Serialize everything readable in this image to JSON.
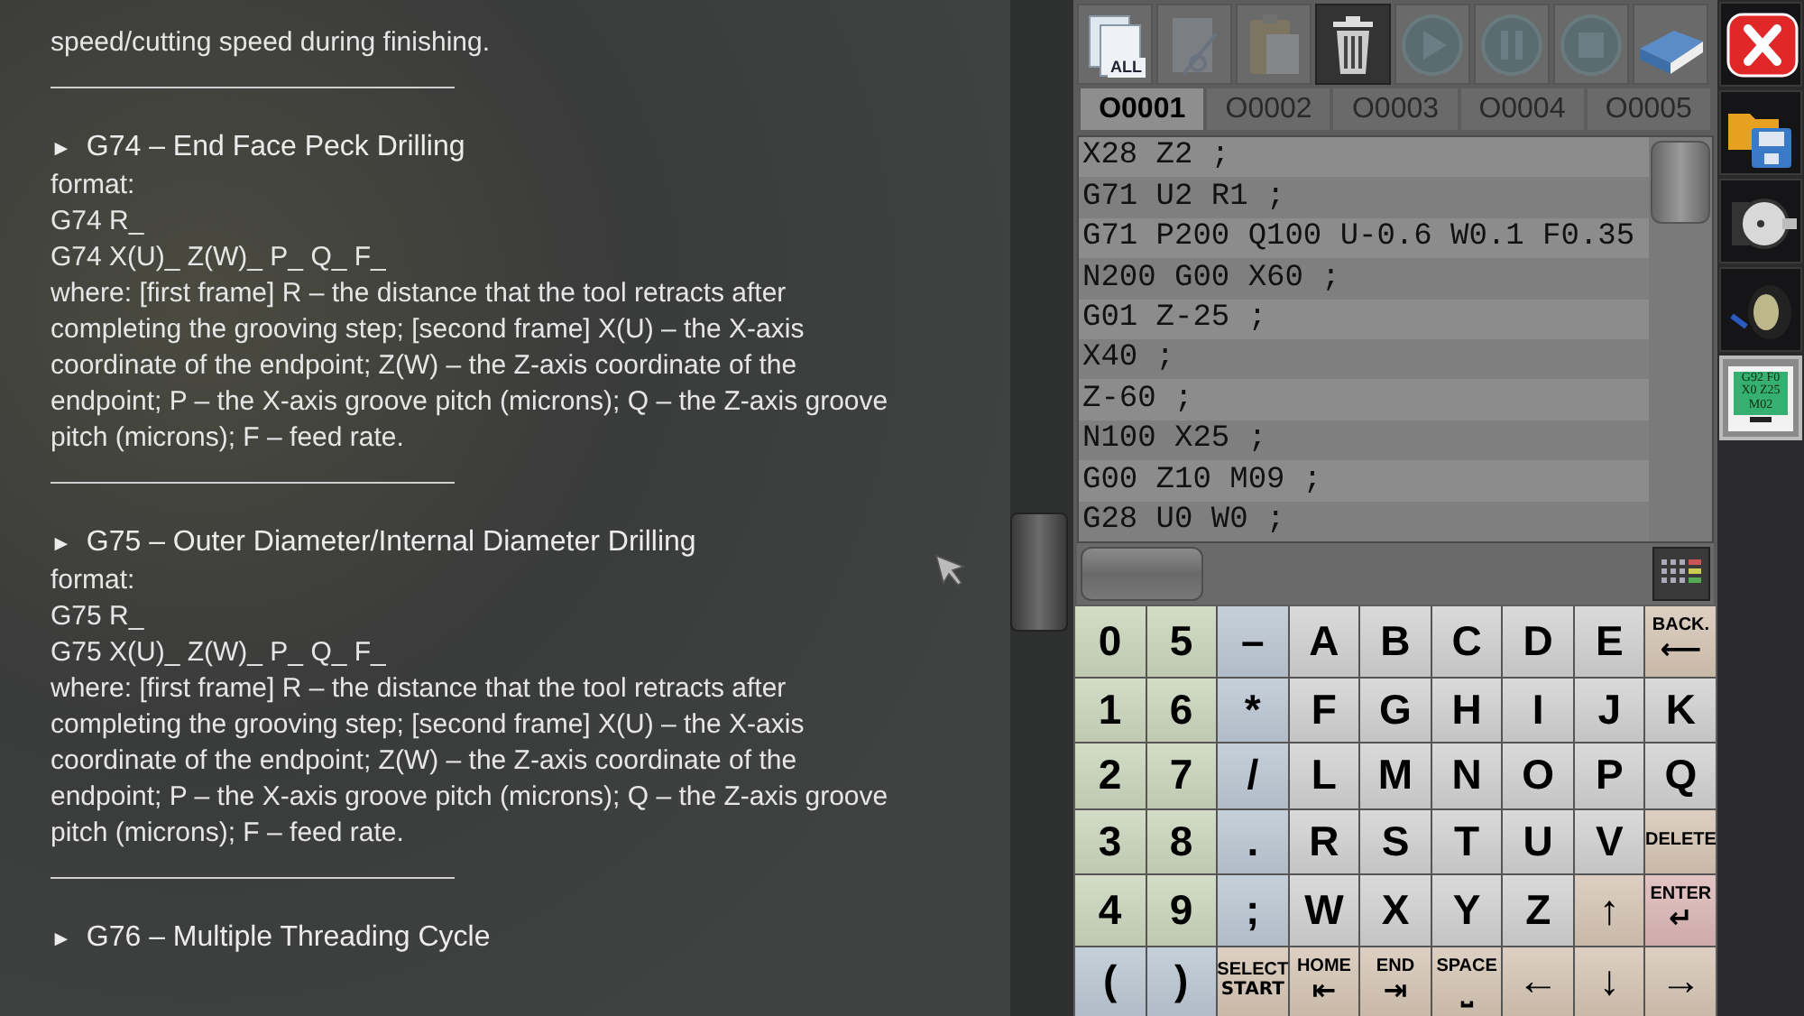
{
  "help_text": {
    "lead_tail": "speed/cutting speed during finishing.",
    "sections": [
      {
        "marker": "►",
        "title": "G74 – End Face Peck Drilling",
        "lines": [
          "format:",
          "G74 R_",
          "G74 X(U)_ Z(W)_ P_ Q_ F_"
        ],
        "description": "where: [first frame] R – the distance that the tool retracts after completing the grooving step; [second frame] X(U) – the X-axis coordinate of the endpoint; Z(W) – the Z-axis coordinate of the endpoint; P – the X-axis groove pitch (microns); Q – the Z-axis groove pitch (microns); F – feed rate."
      },
      {
        "marker": "►",
        "title": "G75 – Outer Diameter/Internal Diameter Drilling",
        "lines": [
          "format:",
          "G75 R_",
          "G75 X(U)_ Z(W)_ P_ Q_ F_"
        ],
        "description": "where: [first frame] R – the distance that the tool retracts after completing the grooving step; [second frame] X(U) – the X-axis coordinate of the endpoint; Z(W) – the Z-axis coordinate of the endpoint; P – the X-axis groove pitch (microns); Q – the Z-axis groove pitch (microns); F – feed rate."
      },
      {
        "marker": "►",
        "title": "G76 – Multiple Threading Cycle"
      }
    ]
  },
  "toolbar": [
    {
      "kind": "select-all",
      "label": "ALL",
      "disabled": false,
      "pressed": false
    },
    {
      "kind": "cut",
      "disabled": true,
      "pressed": false
    },
    {
      "kind": "paste",
      "disabled": true,
      "pressed": false
    },
    {
      "kind": "delete",
      "disabled": false,
      "pressed": true
    },
    {
      "kind": "play",
      "disabled": true,
      "pressed": false
    },
    {
      "kind": "pause",
      "disabled": true,
      "pressed": false
    },
    {
      "kind": "stop",
      "disabled": true,
      "pressed": false
    },
    {
      "kind": "help",
      "disabled": false,
      "pressed": false
    }
  ],
  "program_tabs": [
    {
      "label": "O0001",
      "selected": true
    },
    {
      "label": "O0002",
      "selected": false
    },
    {
      "label": "O0003",
      "selected": false
    },
    {
      "label": "O0004",
      "selected": false
    },
    {
      "label": "O0005",
      "selected": false
    }
  ],
  "editor_lines": [
    "X28 Z2 ;",
    "G71 U2 R1 ;",
    "G71 P200 Q100 U-0.6 W0.1 F0.35",
    "N200 G00 X60 ;",
    "G01 Z-25 ;",
    "X40 ;",
    "Z-60 ;",
    "N100 X25 ;",
    "G00 Z10 M09 ;",
    "G28 U0 W0 ;"
  ],
  "keyboard": [
    [
      {
        "label": "0",
        "kind": "digit"
      },
      {
        "label": "5",
        "kind": "digit"
      },
      {
        "label": "–",
        "kind": "symbol"
      },
      {
        "label": "A",
        "kind": "letter"
      },
      {
        "label": "B",
        "kind": "letter"
      },
      {
        "label": "C",
        "kind": "letter"
      },
      {
        "label": "D",
        "kind": "letter"
      },
      {
        "label": "E",
        "kind": "letter"
      },
      {
        "label": "BACK.",
        "sub": "⟵",
        "kind": "control"
      }
    ],
    [
      {
        "label": "1",
        "kind": "digit"
      },
      {
        "label": "6",
        "kind": "digit"
      },
      {
        "label": "*",
        "kind": "symbol"
      },
      {
        "label": "F",
        "kind": "letter"
      },
      {
        "label": "G",
        "kind": "letter"
      },
      {
        "label": "H",
        "kind": "letter"
      },
      {
        "label": "I",
        "kind": "letter"
      },
      {
        "label": "J",
        "kind": "letter"
      },
      {
        "label": "K",
        "kind": "letter"
      }
    ],
    [
      {
        "label": "2",
        "kind": "digit"
      },
      {
        "label": "7",
        "kind": "digit"
      },
      {
        "label": "/",
        "kind": "symbol"
      },
      {
        "label": "L",
        "kind": "letter"
      },
      {
        "label": "M",
        "kind": "letter"
      },
      {
        "label": "N",
        "kind": "letter"
      },
      {
        "label": "O",
        "kind": "letter"
      },
      {
        "label": "P",
        "kind": "letter"
      },
      {
        "label": "Q",
        "kind": "letter"
      }
    ],
    [
      {
        "label": "3",
        "kind": "digit"
      },
      {
        "label": "8",
        "kind": "digit"
      },
      {
        "label": ".",
        "kind": "symbol"
      },
      {
        "label": "R",
        "kind": "letter"
      },
      {
        "label": "S",
        "kind": "letter"
      },
      {
        "label": "T",
        "kind": "letter"
      },
      {
        "label": "U",
        "kind": "letter"
      },
      {
        "label": "V",
        "kind": "letter"
      },
      {
        "label": "DELETE",
        "kind": "control"
      }
    ],
    [
      {
        "label": "4",
        "kind": "digit"
      },
      {
        "label": "9",
        "kind": "digit"
      },
      {
        "label": ";",
        "kind": "symbol"
      },
      {
        "label": "W",
        "kind": "letter"
      },
      {
        "label": "X",
        "kind": "letter"
      },
      {
        "label": "Y",
        "kind": "letter"
      },
      {
        "label": "Z",
        "kind": "letter"
      },
      {
        "label": "↑",
        "kind": "control"
      },
      {
        "label": "ENTER",
        "sub": "↵",
        "kind": "enter"
      }
    ],
    [
      {
        "label": "(",
        "kind": "symbol"
      },
      {
        "label": ")",
        "kind": "symbol"
      },
      {
        "label": "SELECT",
        "sub": "START",
        "kind": "control"
      },
      {
        "label": "HOME",
        "sub": "⇤",
        "kind": "control"
      },
      {
        "label": "END",
        "sub": "⇥",
        "kind": "control"
      },
      {
        "label": "SPACE",
        "sub": "⎵",
        "kind": "control"
      },
      {
        "label": "←",
        "kind": "control"
      },
      {
        "label": "↓",
        "kind": "control"
      },
      {
        "label": "→",
        "kind": "control"
      }
    ]
  ],
  "side_tools": [
    {
      "kind": "close",
      "selected": false
    },
    {
      "kind": "file",
      "selected": false
    },
    {
      "kind": "chuck",
      "selected": false
    },
    {
      "kind": "turret",
      "selected": false
    },
    {
      "kind": "program-screen",
      "selected": true,
      "screen_lines": [
        "G92 F0",
        "X0 Z25",
        "M02"
      ]
    }
  ]
}
